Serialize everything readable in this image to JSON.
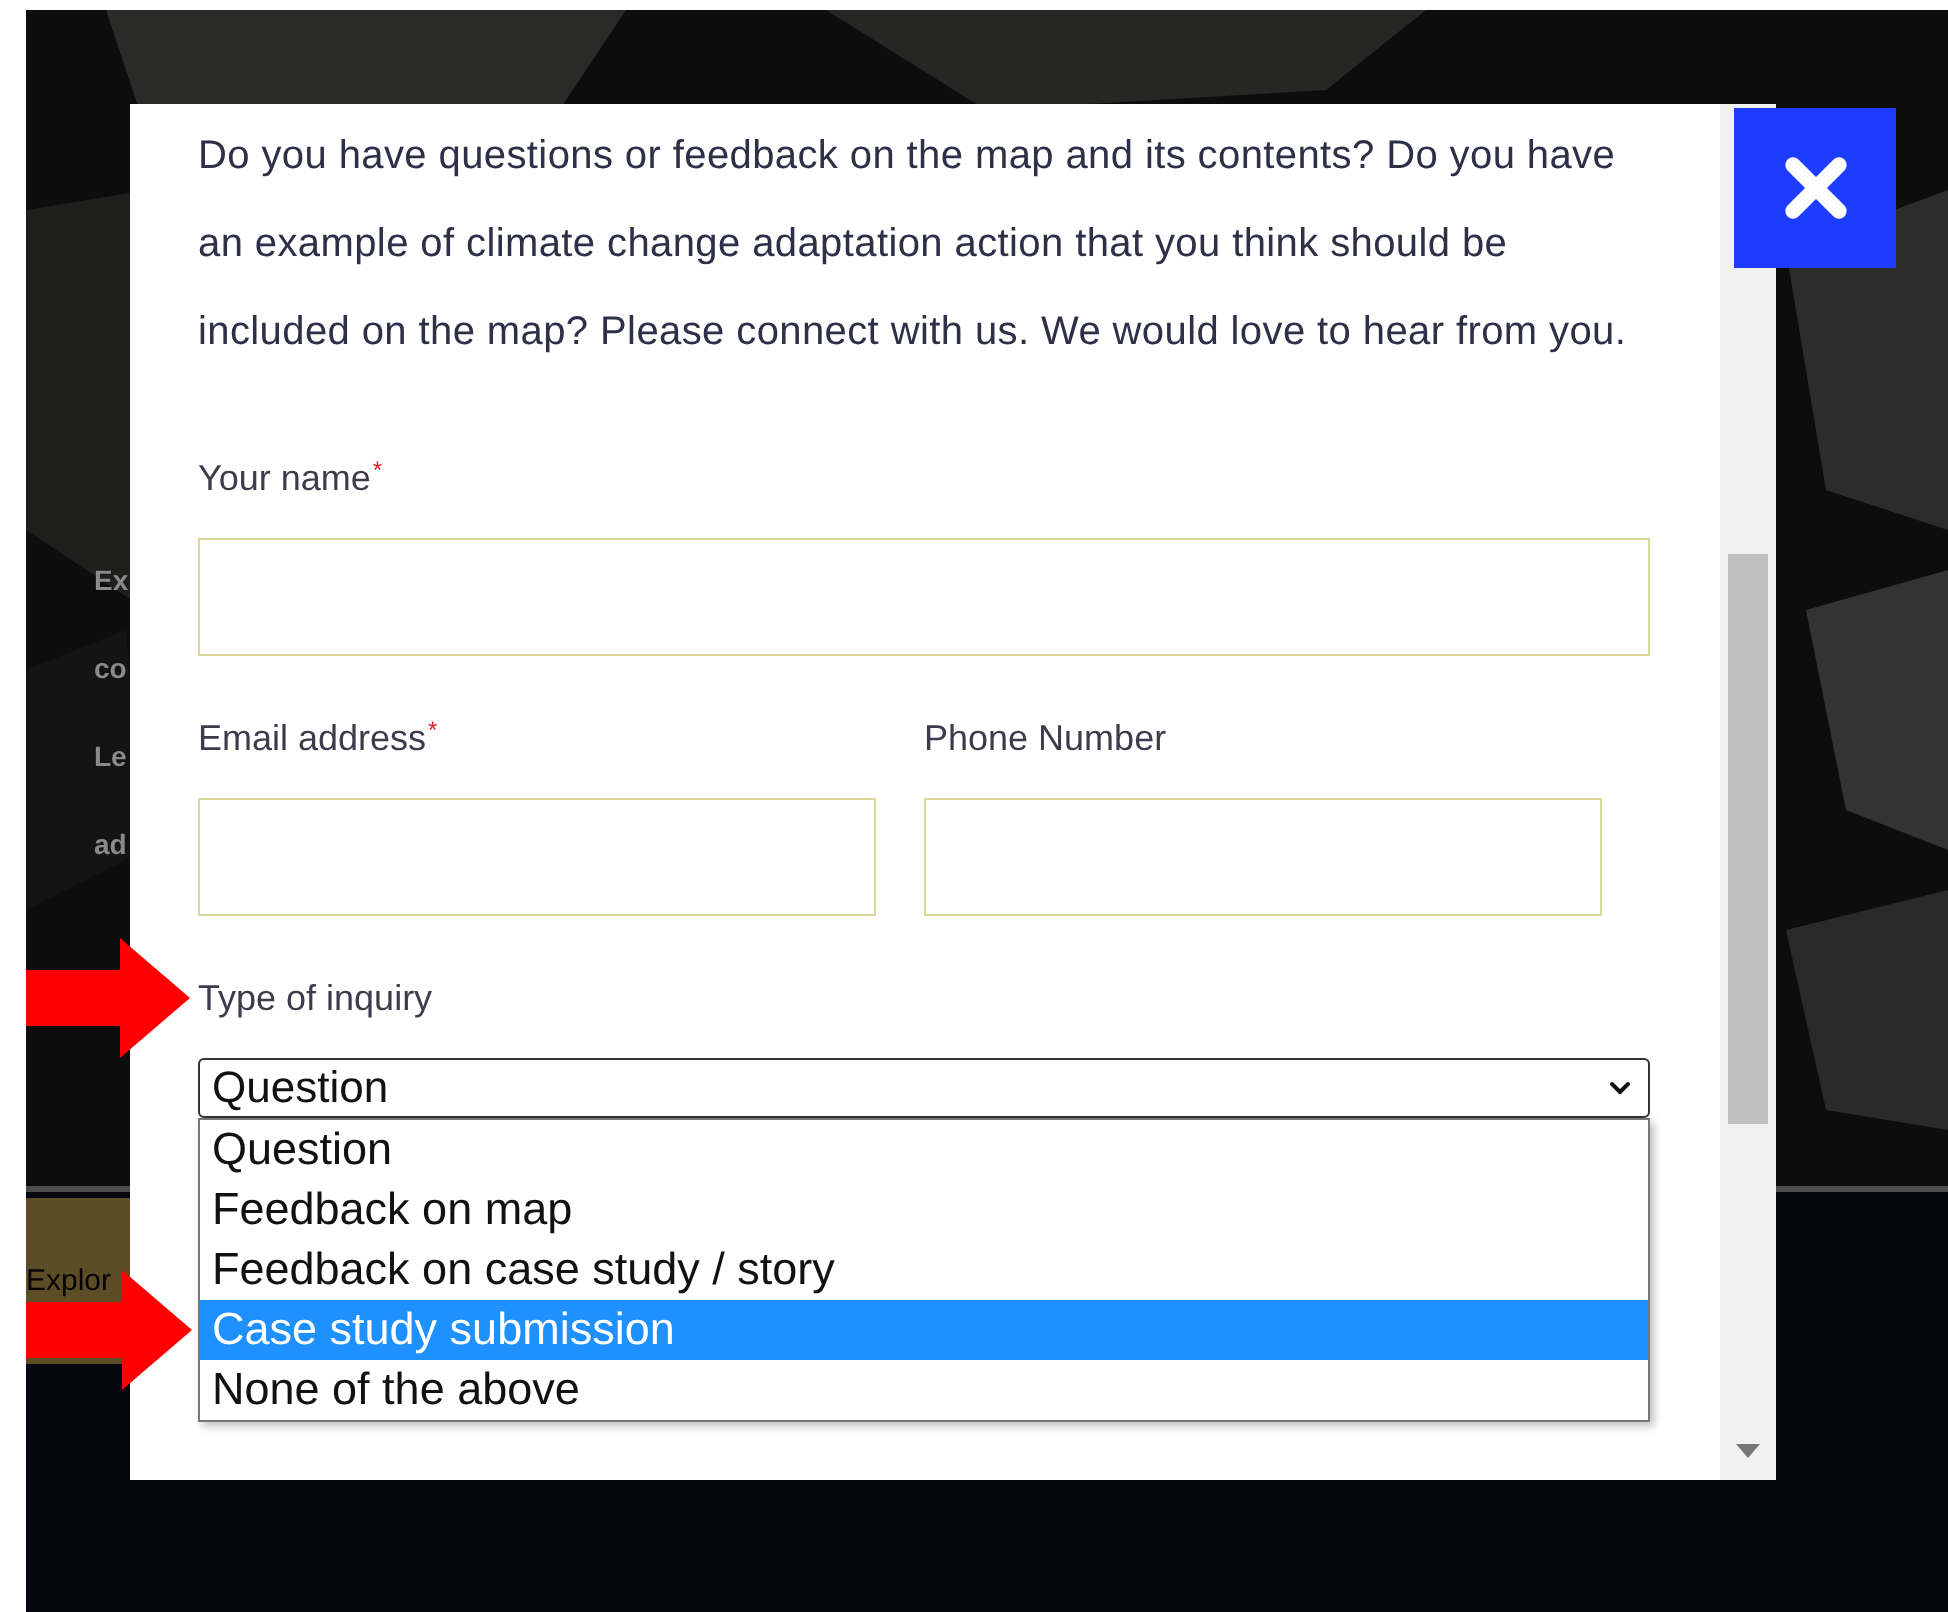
{
  "background": {
    "intro_lines": [
      "Ex",
      "co",
      "Le",
      "ad"
    ],
    "explore_button": "Explor"
  },
  "dialog": {
    "intro": "Do you have questions or feedback on the map and its contents? Do you have an example of climate change adaptation action that you think should be included on the map? Please connect with us. We would love to hear from you.",
    "field_rows": [
      [
        {
          "kind": "text",
          "label": "Your name",
          "required_mark": "*"
        }
      ],
      [
        {
          "kind": "text",
          "label": "Email address",
          "required_mark": "*"
        },
        {
          "kind": "text",
          "label": "Phone Number"
        }
      ]
    ],
    "inquiry": {
      "label": "Type of inquiry",
      "label_annotated": true,
      "value": "Question",
      "expanded": true,
      "options": [
        {
          "label": "Question",
          "highlighted": false,
          "annotated": false
        },
        {
          "label": "Feedback on map",
          "highlighted": false,
          "annotated": false
        },
        {
          "label": "Feedback on case study / story",
          "highlighted": false,
          "annotated": false
        },
        {
          "label": "Case study submission",
          "highlighted": true,
          "annotated": true
        },
        {
          "label": "None of the above",
          "highlighted": false,
          "annotated": false
        }
      ]
    }
  }
}
